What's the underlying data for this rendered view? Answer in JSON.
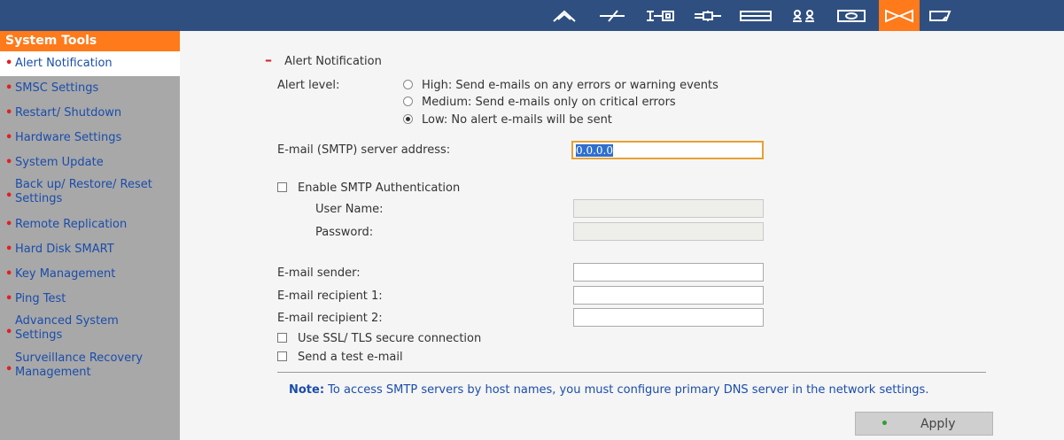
{
  "topbar": {
    "icons": [
      "home-icon",
      "network-icon",
      "device-icon",
      "connection-icon",
      "disk-icon",
      "users-icon",
      "monitor-icon",
      "system-tools-icon",
      "more-icon"
    ]
  },
  "sidebar": {
    "title": "System Tools",
    "items": [
      {
        "line1": "Alert Notification"
      },
      {
        "line1": "SMSC Settings"
      },
      {
        "line1": "Restart/ Shutdown"
      },
      {
        "line1": "Hardware Settings"
      },
      {
        "line1": "System Update"
      },
      {
        "line1": "Back up/ Restore/ Reset",
        "line2": "Settings"
      },
      {
        "line1": "Remote Replication"
      },
      {
        "line1": "Hard Disk SMART"
      },
      {
        "line1": "Key Management"
      },
      {
        "line1": "Ping Test"
      },
      {
        "line1": "Advanced System",
        "line2": "Settings"
      },
      {
        "line1": "Surveillance Recovery",
        "line2": "Management"
      }
    ]
  },
  "main": {
    "section_title": "Alert Notification",
    "alert_level_label": "Alert level:",
    "alert_options": [
      {
        "label": "High: Send e-mails on any errors or warning events",
        "selected": false
      },
      {
        "label": "Medium: Send e-mails only on critical errors",
        "selected": false
      },
      {
        "label": "Low: No alert e-mails will be sent",
        "selected": true
      }
    ],
    "smtp_label": "E-mail (SMTP) server address:",
    "smtp_value": "0.0.0.0",
    "auth_label": "Enable SMTP Authentication",
    "username_label": "User Name:",
    "password_label": "Password:",
    "sender_label": "E-mail sender:",
    "recipient1_label": "E-mail recipient 1:",
    "recipient2_label": "E-mail recipient 2:",
    "ssl_label": "Use SSL/ TLS secure connection",
    "test_label": "Send a test e-mail",
    "note_prefix": "Note:",
    "note_text": " To access SMTP servers by host names, you must configure primary DNS server in the network settings.",
    "apply_label": "Apply"
  }
}
